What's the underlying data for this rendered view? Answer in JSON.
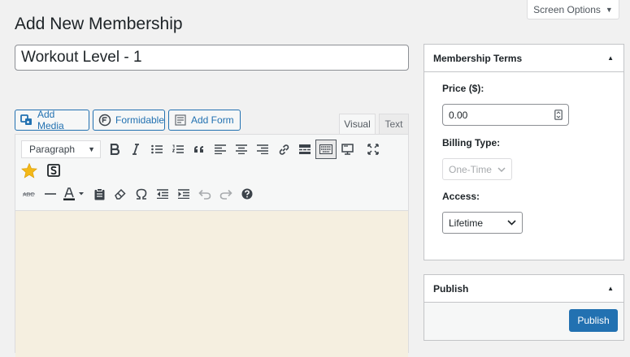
{
  "screen_options": {
    "label": "Screen Options"
  },
  "page": {
    "title": "Add New Membership"
  },
  "post_title": {
    "value": "Workout Level - 1"
  },
  "media_buttons": [
    {
      "label": "Add Media",
      "icon": "media-icon"
    },
    {
      "label": "Formidable",
      "icon": "formidable-icon"
    },
    {
      "label": "Add Form",
      "icon": "form-icon"
    }
  ],
  "editor_tabs": {
    "visual": "Visual",
    "text": "Text"
  },
  "toolbar": {
    "format_selected": "Paragraph"
  },
  "membership_terms": {
    "title": "Membership Terms",
    "price_label": "Price ($):",
    "price_value": "0.00",
    "billing_label": "Billing Type:",
    "billing_value": "One-Time",
    "access_label": "Access:",
    "access_value": "Lifetime"
  },
  "publish_box": {
    "title": "Publish",
    "button": "Publish"
  },
  "colors": {
    "accent": "#2271b1",
    "editor_bg": "#f5efe0"
  }
}
